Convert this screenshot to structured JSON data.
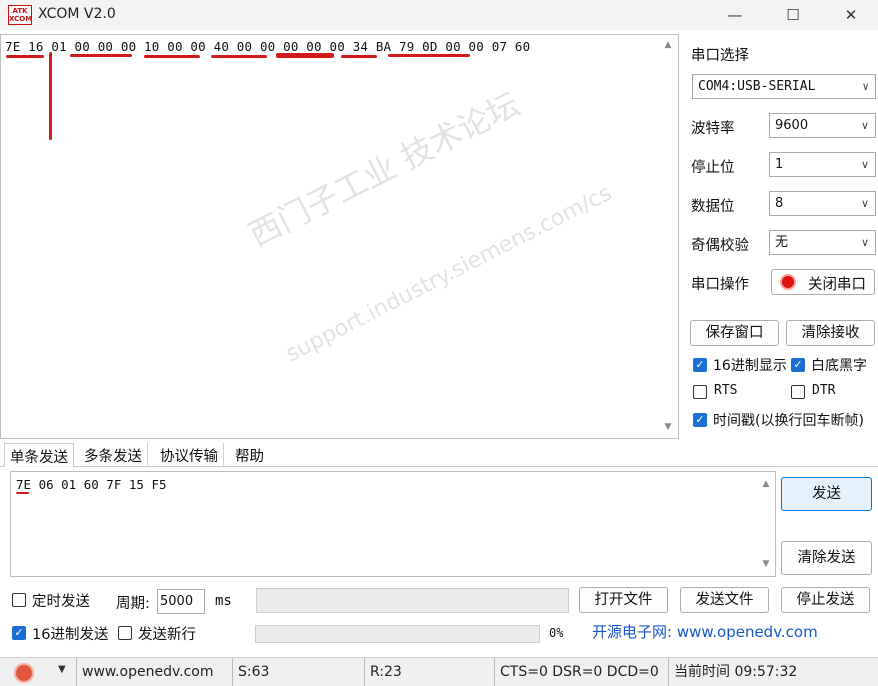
{
  "window": {
    "title": "XCOM V2.0",
    "logo_text": "ATK XCOM",
    "minimize": "—",
    "maximize": "☐",
    "close": "✕"
  },
  "receive": {
    "text": "7E 16 01 00 00 00 10 00 00 40 00 00 00 00 00 34 BA 79 0D 00 00 07 60"
  },
  "watermark": {
    "line1": "西门子工业 技术论坛",
    "line2": "support.industry.siemens.com/cs"
  },
  "serial": {
    "port_label": "串口选择",
    "port_value": "COM4:USB-SERIAL",
    "baud_label": "波特率",
    "baud_value": "9600",
    "stop_label": "停止位",
    "stop_value": "1",
    "data_label": "数据位",
    "data_value": "8",
    "parity_label": "奇偶校验",
    "parity_value": "无",
    "op_label": "串口操作",
    "op_button": "关闭串口"
  },
  "options": {
    "save_window": "保存窗口",
    "clear_receive": "清除接收",
    "hex_display": "16进制显示",
    "white_bg": "白底黑字",
    "rts": "RTS",
    "dtr": "DTR",
    "timestamp": "时间戳(以换行回车断帧)"
  },
  "tabs": [
    "单条发送",
    "多条发送",
    "协议传输",
    "帮助"
  ],
  "send": {
    "text": "7E 06 01 60 7F 15 F5",
    "send_button": "发送",
    "clear_send_button": "清除发送",
    "timed_send": "定时发送",
    "period_label": "周期:",
    "period_value": "5000",
    "period_unit": "ms",
    "open_file": "打开文件",
    "send_file": "发送文件",
    "stop_send": "停止发送",
    "hex_send": "16进制发送",
    "send_newline": "发送新行",
    "progress_percent": "0%",
    "banner": "开源电子网: www.openedv.com"
  },
  "status": {
    "url": "www.openedv.com",
    "sent": "S:63",
    "received": "R:23",
    "lines": "CTS=0 DSR=0 DCD=0",
    "time_label": "当前时间 09:57:32"
  },
  "colors": {
    "accent": "#1a6fd1",
    "annotation_red": "#d21a1a",
    "link_blue": "#1a57c9"
  }
}
